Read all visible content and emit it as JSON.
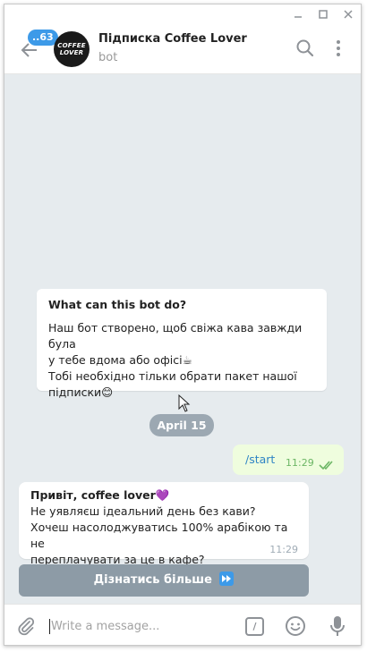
{
  "window": {
    "controls": [
      "minimize-icon",
      "maximize-icon",
      "close-icon"
    ]
  },
  "header": {
    "unread_badge": "..63",
    "avatar_text_line1": "COFFEE",
    "avatar_text_line2": "LOVER",
    "title": "Підписка Coffee Lover",
    "subtitle": "bot",
    "icons": [
      "back-arrow-icon",
      "search-icon",
      "more-vertical-icon"
    ]
  },
  "bot_info": {
    "title": "What can this bot do?",
    "line1": "Наш бот створено, щоб свіжа кава завжди була",
    "line2": "у тебе вдома або офісі☕",
    "line3": "Тобі необхідно тільки обрати пакет нашої",
    "line4": "підписки😊"
  },
  "date_separator": "April 15",
  "outgoing_message": {
    "text": "/start",
    "time": "11:29",
    "status_icon": "double-check-icon"
  },
  "incoming_message": {
    "line1": "Привіт, coffee lover💜",
    "line2": "Не уявляєш ідеальний день без кави?",
    "line3": "Хочеш насолоджуватись 100% арабікою та не",
    "line4": "переплачувати за це в кафе?",
    "time": "11:29"
  },
  "inline_button": {
    "label": "Дізнатись більше",
    "icon": "fast-forward-icon"
  },
  "composer": {
    "placeholder": "Write a message...",
    "command_label": "/",
    "icons": [
      "attach-icon",
      "bot-command-icon",
      "emoji-icon",
      "microphone-icon"
    ]
  },
  "colors": {
    "accent": "#3d9ae8",
    "chat_background": "#e6ebee",
    "outgoing_bubble": "#effdde",
    "inline_button": "#8d9ba6"
  }
}
